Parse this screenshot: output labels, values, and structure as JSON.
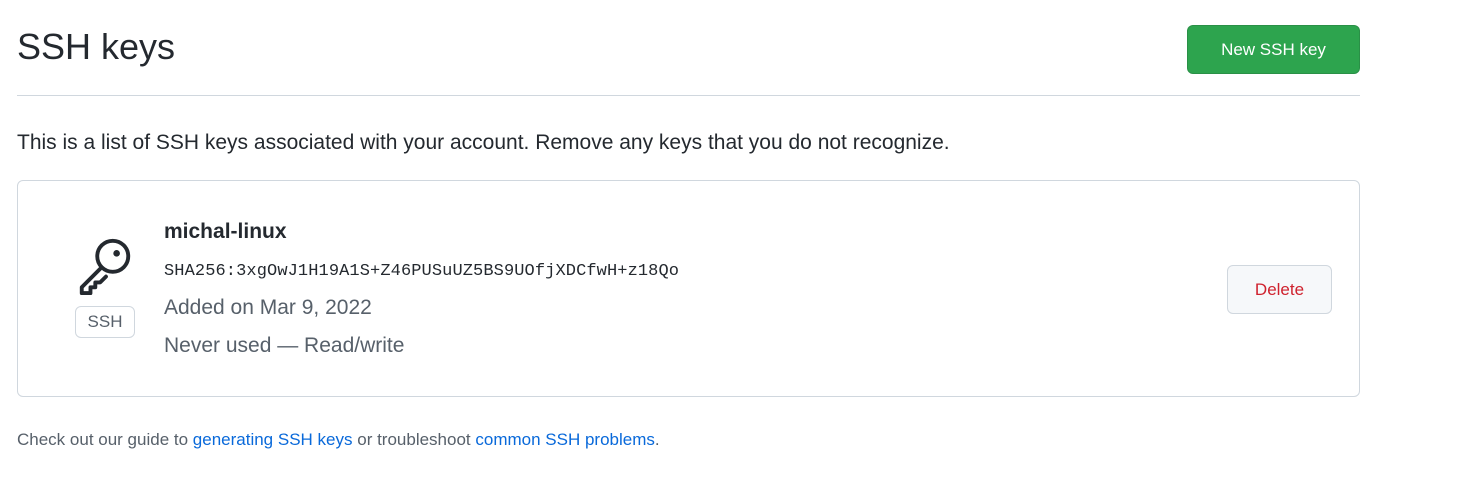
{
  "header": {
    "title": "SSH keys",
    "new_key_label": "New SSH key"
  },
  "description": "This is a list of SSH keys associated with your account. Remove any keys that you do not recognize.",
  "ssh_keys": [
    {
      "title": "michal-linux",
      "fingerprint": "SHA256:3xgOwJ1H19A1S+Z46PUSuUZ5BS9UOfjXDCfwH+z18Qo",
      "added": "Added on Mar 9, 2022",
      "usage": "Never used — Read/write",
      "type_badge": "SSH",
      "delete_label": "Delete",
      "icon": "key-icon"
    }
  ],
  "footer": {
    "prefix": "Check out our guide to",
    "link1": "generating SSH keys",
    "middle": "or troubleshoot",
    "link2": "common SSH problems",
    "suffix": "."
  },
  "colors": {
    "primary_button": "#2da44e",
    "danger_text": "#cf222e",
    "link": "#0969da",
    "muted_text": "#57606a",
    "border": "#d0d7de"
  }
}
